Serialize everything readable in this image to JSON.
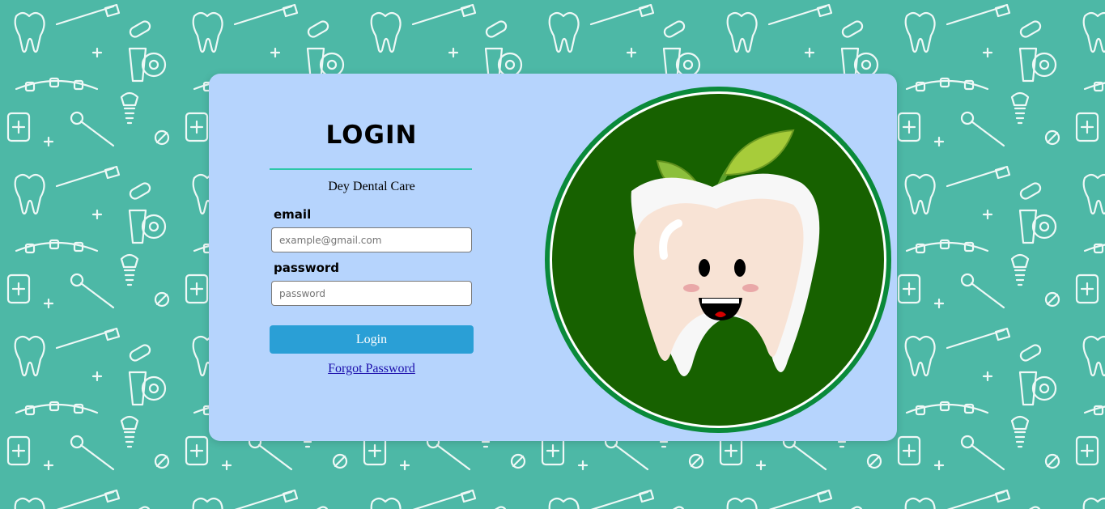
{
  "login": {
    "title": "LOGIN",
    "subtitle": "Dey Dental Care",
    "email_label": "email",
    "email_placeholder": "example@gmail.com",
    "email_value": "",
    "password_label": "password",
    "password_placeholder": "password",
    "password_value": "",
    "submit_label": "Login",
    "forgot_label": "Forgot Password"
  },
  "theme": {
    "page_background": "#4db8a6",
    "card_background": "#b6d4fd",
    "button_color": "#2a9fd6",
    "accent_rule": "#2cc7a8",
    "logo_ring": "#0a8a3a",
    "logo_fill": "#176100"
  },
  "icons": {
    "background": "dental-pattern-icons",
    "logo": "smiling-tooth-with-leaves-logo"
  }
}
